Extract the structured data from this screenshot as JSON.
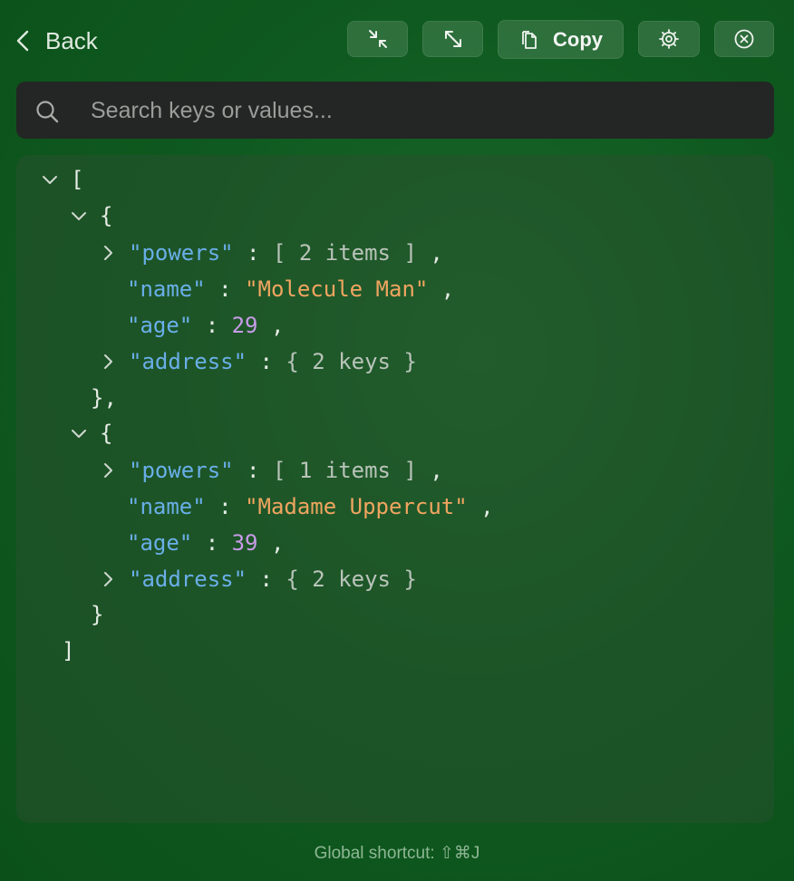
{
  "toolbar": {
    "back_label": "Back",
    "copy_label": "Copy",
    "buttons": [
      "collapse-icon",
      "expand-icon",
      "copy-icon",
      "gear-icon",
      "close-icon"
    ]
  },
  "search": {
    "placeholder": "Search keys or values..."
  },
  "json_tree": {
    "open_bracket": "[",
    "close_bracket": "]",
    "items": [
      {
        "open": "{",
        "close": "},",
        "powers_key": "\"powers\"",
        "powers_summary": "[ 2 items ]",
        "name_key": "\"name\"",
        "name_value": "\"Molecule Man\"",
        "age_key": "\"age\"",
        "age_value": "29",
        "address_key": "\"address\"",
        "address_summary": "{ 2 keys }"
      },
      {
        "open": "{",
        "close": "}",
        "powers_key": "\"powers\"",
        "powers_summary": "[ 1 items ]",
        "name_key": "\"name\"",
        "name_value": "\"Madame Uppercut\"",
        "age_key": "\"age\"",
        "age_value": "39",
        "address_key": "\"address\"",
        "address_summary": "{ 2 keys }"
      }
    ]
  },
  "footer": {
    "shortcut_text": "Global shortcut: ⇧⌘J"
  },
  "colors": {
    "key": "#6aaee8",
    "string": "#f0a560",
    "number": "#c79be8",
    "background": "#0f5a20"
  }
}
